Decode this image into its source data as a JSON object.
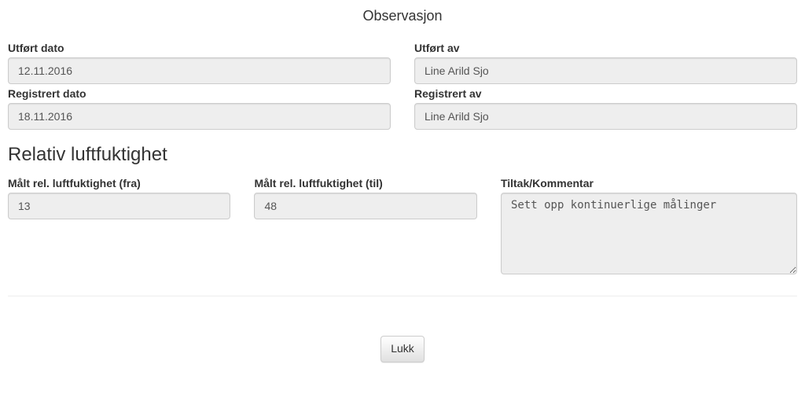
{
  "page_title": "Observasjon",
  "header": {
    "performed_date": {
      "label": "Utført dato",
      "value": "12.11.2016"
    },
    "performed_by": {
      "label": "Utført av",
      "value": "Line Arild Sjo"
    },
    "registered_date": {
      "label": "Registrert dato",
      "value": "18.11.2016"
    },
    "registered_by": {
      "label": "Registrert av",
      "value": "Line Arild Sjo"
    }
  },
  "section": {
    "title": "Relativ luftfuktighet",
    "from": {
      "label": "Målt rel. luftfuktighet (fra)",
      "value": "13"
    },
    "to": {
      "label": "Målt rel. luftfuktighet (til)",
      "value": "48"
    },
    "comment": {
      "label": "Tiltak/Kommentar",
      "value": "Sett opp kontinuerlige målinger"
    }
  },
  "actions": {
    "close": "Lukk"
  }
}
